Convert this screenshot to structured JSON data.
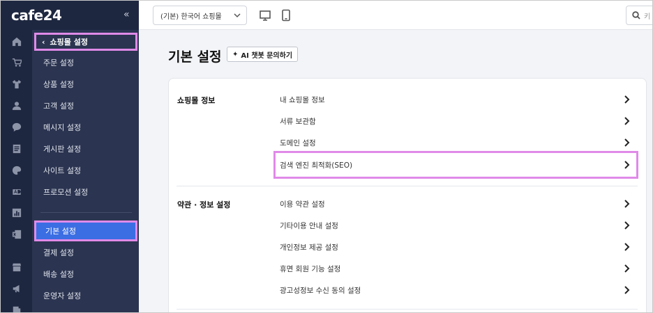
{
  "brand": {
    "logo": "cafe24",
    "collapse_label": "«"
  },
  "rail_icons": [
    "home-icon",
    "cart-icon",
    "shirt-icon",
    "person-icon",
    "chat-icon",
    "board-icon",
    "palette-icon",
    "ad-icon",
    "stats-icon",
    "excel-icon",
    "store-icon",
    "megaphone-icon",
    "add-page-icon"
  ],
  "submenu": {
    "header_label": "쇼핑몰 설정",
    "items": [
      "주문 설정",
      "상품 설정",
      "고객 설정",
      "메시지 설정",
      "게시판 설정",
      "사이트 설정",
      "프로모션 설정"
    ],
    "active_item": "기본 설정",
    "items_after": [
      "결제 설정",
      "배송 설정",
      "운영자 설정"
    ]
  },
  "topbar": {
    "shop_select_value": "(기본) 한국어 쇼핑몰",
    "search_placeholder": "키"
  },
  "page": {
    "title": "기본 설정",
    "ai_button_label": "AI 챗봇 문의하기"
  },
  "sections": [
    {
      "title": "쇼핑몰 정보",
      "rows": [
        "내 쇼핑몰 정보",
        "서류 보관함",
        "도메인 설정",
        "검색 엔진 최적화(SEO)"
      ]
    },
    {
      "title": "약관 · 정보 설정",
      "rows": [
        "이용 약관 설정",
        "기타이용 안내 설정",
        "개인정보 제공 설정",
        "휴면 회원 기능 설정",
        "광고성정보 수신 동의 설정"
      ]
    }
  ],
  "colors": {
    "sidebar_bg": "#1e2740",
    "submenu_bg": "#2b3450",
    "active_bg": "#3b6de3",
    "highlight_border": "#e08ae8"
  }
}
